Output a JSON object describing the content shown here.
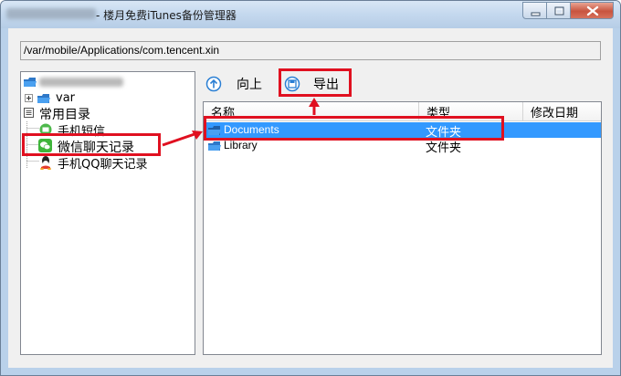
{
  "window": {
    "title": "- 楼月免费iTunes备份管理器",
    "device_name_label": "Jackie's iphone6",
    "buttons": {
      "minimize": "minimize",
      "maximize": "maximize",
      "close": "close"
    }
  },
  "path": "/var/mobile/Applications/com.tencent.xin",
  "tree": {
    "root": "Jackie's iphone6",
    "items": [
      {
        "label": "var",
        "icon": "folder-icon"
      },
      {
        "label": "常用目录",
        "icon": "list-icon"
      },
      {
        "label": "手机短信",
        "icon": "sms-icon"
      },
      {
        "label": "微信聊天记录",
        "icon": "wechat-icon"
      },
      {
        "label": "手机QQ聊天记录",
        "icon": "qq-icon"
      }
    ]
  },
  "toolbar": {
    "up_label": "向上",
    "export_label": "导出"
  },
  "list": {
    "columns": [
      "名称",
      "类型",
      "修改日期"
    ],
    "rows": [
      {
        "name": "Documents",
        "type": "文件夹",
        "date": "",
        "selected": true
      },
      {
        "name": "Library",
        "type": "文件夹",
        "date": "",
        "selected": false
      }
    ]
  },
  "colors": {
    "selection": "#3399ff",
    "annotation_red": "#e01020",
    "title_bar": "#c4d8ee",
    "close_button": "#c8543f"
  }
}
